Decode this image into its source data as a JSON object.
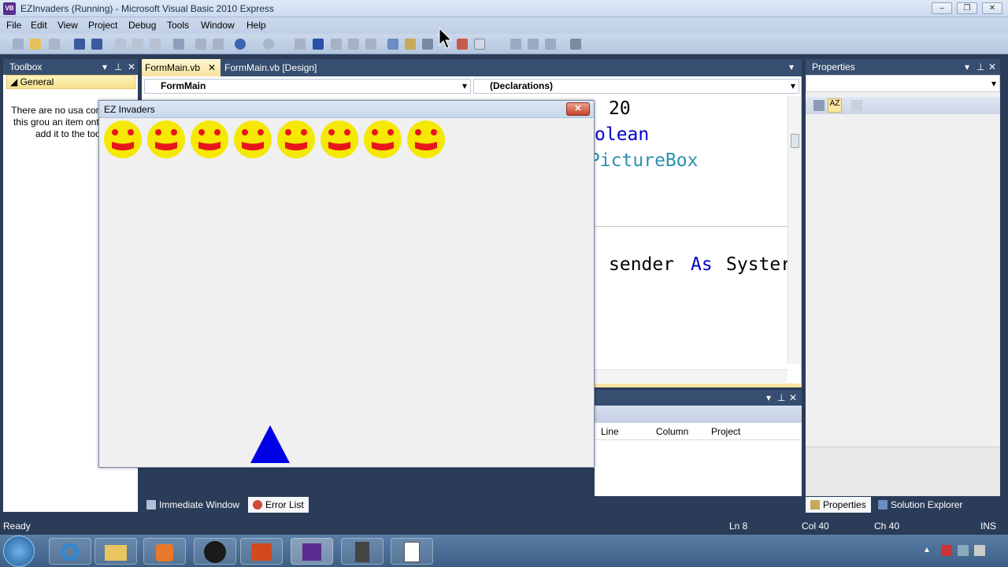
{
  "window": {
    "title": "EZInvaders (Running) - Microsoft Visual Basic 2010 Express",
    "app_icon_text": "VB"
  },
  "menu": [
    "File",
    "Edit",
    "View",
    "Project",
    "Debug",
    "Tools",
    "Window",
    "Help"
  ],
  "toolbox": {
    "title": "Toolbox",
    "group": "General",
    "empty_message": "There are no usa controls in this grou an item onto this t add it to the tooll"
  },
  "editor": {
    "tabs": [
      {
        "label": "FormMain.vb",
        "active": true
      },
      {
        "label": "FormMain.vb [Design]",
        "active": false
      }
    ],
    "class_combo": "FormMain",
    "member_combo": "(Declarations)",
    "code_fragments": [
      {
        "text": "20",
        "color": "#000000"
      },
      {
        "text": "olean",
        "color": "#0000c8"
      },
      {
        "text": "PictureBox",
        "color": "#2b91af"
      },
      {
        "text": "sender",
        "color": "#000000"
      },
      {
        "text": "As",
        "color": "#0000c8"
      },
      {
        "text": "Syster",
        "color": "#000000"
      }
    ]
  },
  "error_list": {
    "columns": [
      "Line",
      "Column",
      "Project"
    ]
  },
  "bottom_tabs": [
    "Immediate Window",
    "Error List"
  ],
  "properties": {
    "title": "Properties"
  },
  "right_bottom_tabs": [
    "Properties",
    "Solution Explorer"
  ],
  "game_form": {
    "title": "EZ Invaders",
    "close": "✕",
    "invader_count": 8,
    "invader_color": "#f4e804",
    "feature_color": "#e8161c",
    "player_color": "#0000e6"
  },
  "status": {
    "ready": "Ready",
    "line": "Ln 8",
    "col": "Col 40",
    "ch": "Ch 40",
    "mode": "INS"
  }
}
